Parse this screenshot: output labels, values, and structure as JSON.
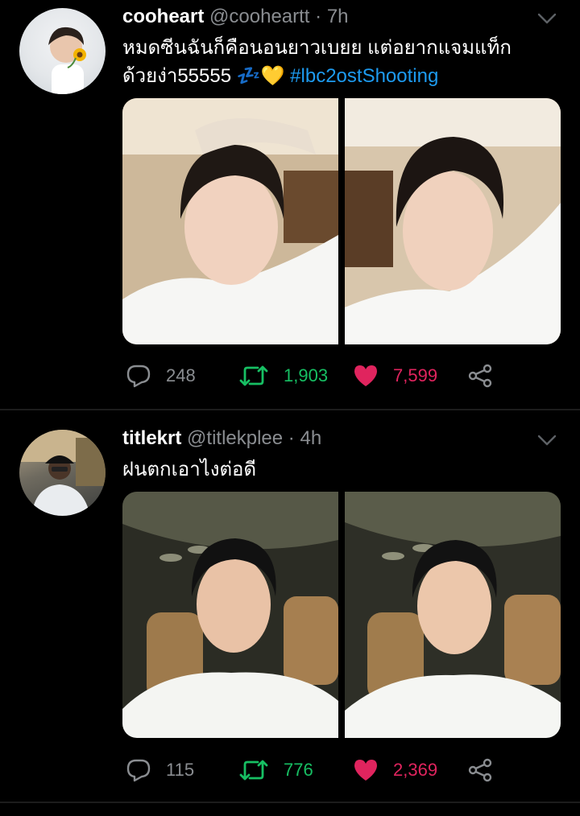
{
  "tweets": [
    {
      "name": "cooheart",
      "handle": "@cooheartt",
      "separator": "·",
      "time": "7h",
      "text_line1": "หมดซีนฉันก็คือนอนยาวเบยย แต่อยากแจมแท็ก",
      "text_line2": "ด้วยง่า55555",
      "emoji": "💤💛",
      "hashtag": "#lbc2ostShooting",
      "replies": "248",
      "retweets": "1,903",
      "likes": "7,599"
    },
    {
      "name": "titlekrt",
      "handle": "@titlekplee",
      "separator": "·",
      "time": "4h",
      "text_line1": "ฝนตกเอาไงต่อดี",
      "replies": "115",
      "retweets": "776",
      "likes": "2,369"
    }
  ],
  "icons": [
    "reply-icon",
    "retweet-icon",
    "like-icon",
    "share-icon",
    "chevron-down-icon"
  ],
  "colors": {
    "background": "#000000",
    "hashtag": "#1d9bf0",
    "retweet": "#17bf63",
    "like": "#e0245e",
    "muted": "#8a8d91"
  }
}
